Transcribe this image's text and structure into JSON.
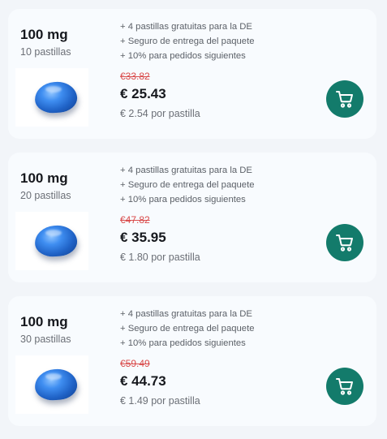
{
  "products": [
    {
      "dose": "100 mg",
      "count": "10 pastillas",
      "benefits": [
        "+ 4 pastillas gratuitas para la DE",
        "+ Seguro de entrega del paquete",
        "+ 10% para pedidos siguientes"
      ],
      "old_price": "€33.82",
      "price": "€ 25.43",
      "unit_price": "€ 2.54 por pastilla"
    },
    {
      "dose": "100 mg",
      "count": "20 pastillas",
      "benefits": [
        "+ 4 pastillas gratuitas para la DE",
        "+ Seguro de entrega del paquete",
        "+ 10% para pedidos siguientes"
      ],
      "old_price": "€47.82",
      "price": "€ 35.95",
      "unit_price": "€ 1.80 por pastilla"
    },
    {
      "dose": "100 mg",
      "count": "30 pastillas",
      "benefits": [
        "+ 4 pastillas gratuitas para la DE",
        "+ Seguro de entrega del paquete",
        "+ 10% para pedidos siguientes"
      ],
      "old_price": "€59.49",
      "price": "€ 44.73",
      "unit_price": "€ 1.49 por pastilla"
    }
  ],
  "icons": {
    "product_image": "blue-pill-image",
    "cart": "cart-icon"
  },
  "colors": {
    "cart_button": "#137b6b",
    "old_price": "#d94b4b",
    "card_bg": "#f8fbfe",
    "page_bg": "#f2f5f9"
  }
}
